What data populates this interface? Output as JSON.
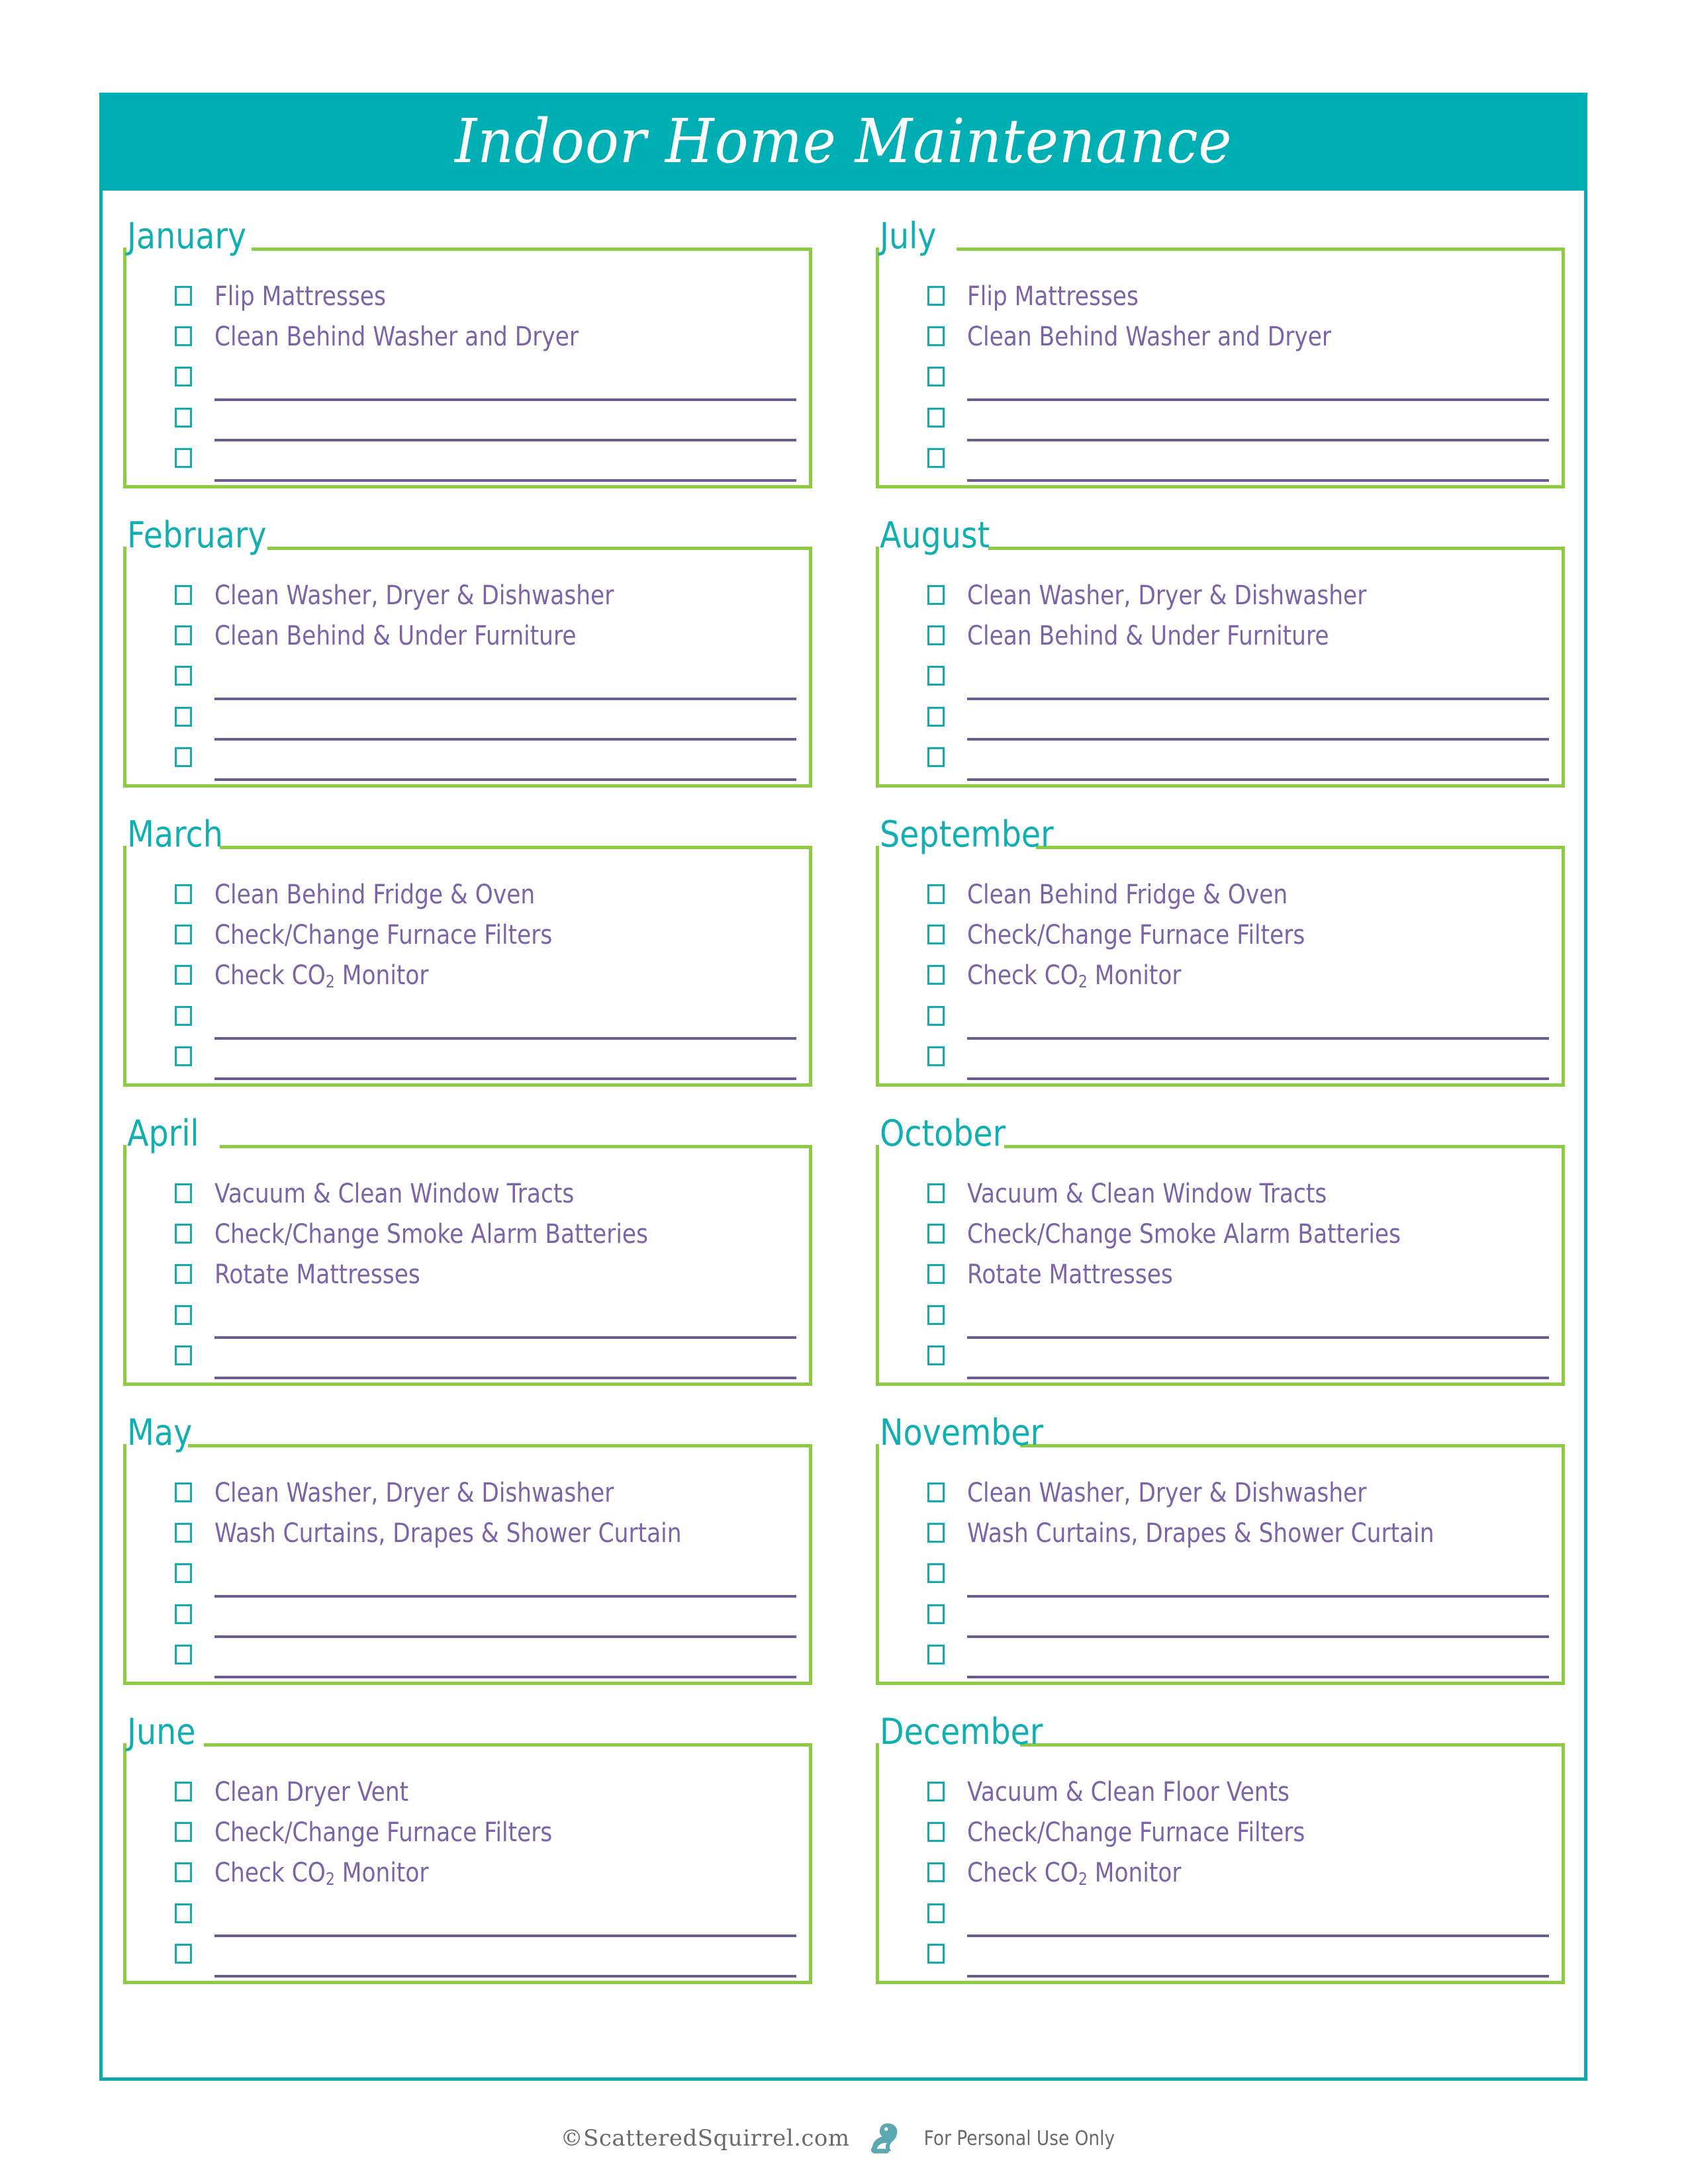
{
  "document": {
    "title": "Indoor Home Maintenance"
  },
  "colors": {
    "teal": "#00AFB4",
    "green": "#8DCB43",
    "purple_text": "#7B64A8",
    "purple_line": "#6D5C91",
    "white": "#FFFFFF"
  },
  "months": [
    {
      "name": "January",
      "items": [
        {
          "label": "Flip Mattresses",
          "blank": false
        },
        {
          "label": "Clean Behind Washer and Dryer",
          "blank": false
        },
        {
          "label": "",
          "blank": true
        },
        {
          "label": "",
          "blank": true
        },
        {
          "label": "",
          "blank": true
        }
      ]
    },
    {
      "name": "July",
      "items": [
        {
          "label": "Flip Mattresses",
          "blank": false
        },
        {
          "label": "Clean Behind Washer and Dryer",
          "blank": false
        },
        {
          "label": "",
          "blank": true
        },
        {
          "label": "",
          "blank": true
        },
        {
          "label": "",
          "blank": true
        }
      ]
    },
    {
      "name": "February",
      "items": [
        {
          "label": "Clean Washer, Dryer & Dishwasher",
          "blank": false
        },
        {
          "label": "Clean Behind & Under Furniture",
          "blank": false
        },
        {
          "label": "",
          "blank": true
        },
        {
          "label": "",
          "blank": true
        },
        {
          "label": "",
          "blank": true
        }
      ]
    },
    {
      "name": "August",
      "items": [
        {
          "label": "Clean Washer, Dryer & Dishwasher",
          "blank": false
        },
        {
          "label": "Clean Behind & Under Furniture",
          "blank": false
        },
        {
          "label": "",
          "blank": true
        },
        {
          "label": "",
          "blank": true
        },
        {
          "label": "",
          "blank": true
        }
      ]
    },
    {
      "name": "March",
      "items": [
        {
          "label": "Clean Behind Fridge & Oven",
          "blank": false
        },
        {
          "label": "Check/Change Furnace Filters",
          "blank": false
        },
        {
          "label": "Check CO2 Monitor",
          "blank": false,
          "subscript": true
        },
        {
          "label": "",
          "blank": true
        },
        {
          "label": "",
          "blank": true
        }
      ]
    },
    {
      "name": "September",
      "items": [
        {
          "label": "Clean Behind Fridge & Oven",
          "blank": false
        },
        {
          "label": "Check/Change Furnace Filters",
          "blank": false
        },
        {
          "label": "Check CO2 Monitor",
          "blank": false,
          "subscript": true
        },
        {
          "label": "",
          "blank": true
        },
        {
          "label": "",
          "blank": true
        }
      ]
    },
    {
      "name": "April",
      "items": [
        {
          "label": "Vacuum & Clean Window Tracts",
          "blank": false
        },
        {
          "label": "Check/Change Smoke Alarm Batteries",
          "blank": false
        },
        {
          "label": "Rotate Mattresses",
          "blank": false
        },
        {
          "label": "",
          "blank": true
        },
        {
          "label": "",
          "blank": true
        }
      ]
    },
    {
      "name": "October",
      "items": [
        {
          "label": "Vacuum & Clean Window Tracts",
          "blank": false
        },
        {
          "label": "Check/Change Smoke Alarm Batteries",
          "blank": false
        },
        {
          "label": "Rotate Mattresses",
          "blank": false
        },
        {
          "label": "",
          "blank": true
        },
        {
          "label": "",
          "blank": true
        }
      ]
    },
    {
      "name": "May",
      "items": [
        {
          "label": "Clean Washer, Dryer & Dishwasher",
          "blank": false
        },
        {
          "label": "Wash Curtains, Drapes & Shower Curtain",
          "blank": false
        },
        {
          "label": "",
          "blank": true
        },
        {
          "label": "",
          "blank": true
        },
        {
          "label": "",
          "blank": true
        }
      ]
    },
    {
      "name": "November",
      "items": [
        {
          "label": "Clean Washer, Dryer & Dishwasher",
          "blank": false
        },
        {
          "label": "Wash Curtains, Drapes & Shower Curtain",
          "blank": false
        },
        {
          "label": "",
          "blank": true
        },
        {
          "label": "",
          "blank": true
        },
        {
          "label": "",
          "blank": true
        }
      ]
    },
    {
      "name": "June",
      "items": [
        {
          "label": "Clean Dryer Vent",
          "blank": false
        },
        {
          "label": "Check/Change Furnace Filters",
          "blank": false
        },
        {
          "label": "Check CO2 Monitor",
          "blank": false,
          "subscript": true
        },
        {
          "label": "",
          "blank": true
        },
        {
          "label": "",
          "blank": true
        }
      ]
    },
    {
      "name": "December",
      "items": [
        {
          "label": "Vacuum & Clean Floor Vents",
          "blank": false
        },
        {
          "label": "Check/Change Furnace Filters",
          "blank": false
        },
        {
          "label": "Check CO2 Monitor",
          "blank": false,
          "subscript": true
        },
        {
          "label": "",
          "blank": true
        },
        {
          "label": "",
          "blank": true
        }
      ]
    }
  ],
  "footer": {
    "copyright": "©ScatteredSquirrel.com",
    "icon": "squirrel-icon",
    "usage": "For Personal Use Only"
  }
}
